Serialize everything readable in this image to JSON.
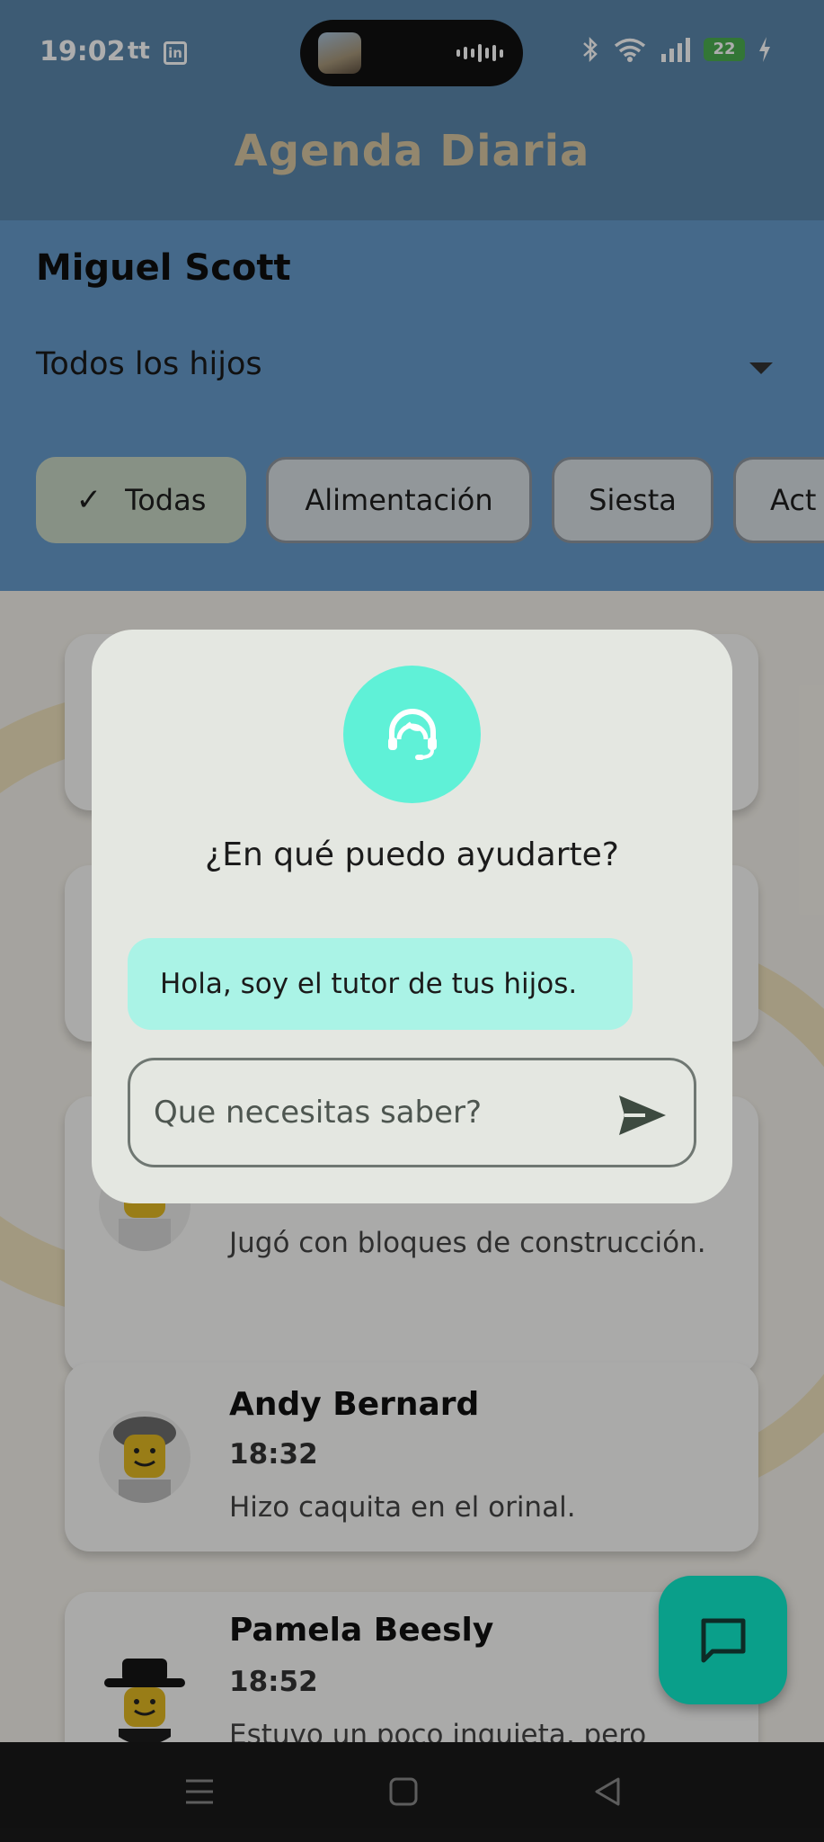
{
  "status_bar": {
    "time": "19:02",
    "app_icons": [
      "tiktok-icon",
      "linkedin-icon"
    ],
    "tiktok_label": "tt",
    "linkedin_label": "in",
    "battery": "22"
  },
  "app_bar": {
    "title": "Agenda Diaria"
  },
  "header": {
    "user_name": "Miguel Scott",
    "child_select": "Todos los hijos",
    "chips": [
      {
        "label": "Todas",
        "selected": true
      },
      {
        "label": "Alimentación",
        "selected": false
      },
      {
        "label": "Siesta",
        "selected": false
      },
      {
        "label": "Act",
        "selected": false
      }
    ]
  },
  "entries": [
    {
      "name": "",
      "time": "",
      "description": ""
    },
    {
      "name": "",
      "time": "",
      "description": ""
    },
    {
      "name": "",
      "time": "",
      "description": "Jugó con bloques de construcción."
    },
    {
      "name": "Andy Bernard",
      "time": "18:32",
      "description": "Hizo caquita en el orinal."
    },
    {
      "name": "Pamela Beesly",
      "time": "18:52",
      "description": "Estuvo un poco inquieta, pero luego se calmó."
    }
  ],
  "dialog": {
    "icon": "support-agent-icon",
    "title": "¿En qué puedo ayudarte?",
    "message": "Hola, soy el tutor de tus hijos.",
    "input_placeholder": "Que necesitas saber?",
    "send_icon": "send-icon"
  },
  "fab": {
    "icon": "chat-icon"
  },
  "colors": {
    "app_bar": "#5b86ac",
    "header": "#669bcc",
    "accent": "#5ff1d7",
    "fab": "#0a9f8a",
    "bubble": "#aaf3e6"
  }
}
